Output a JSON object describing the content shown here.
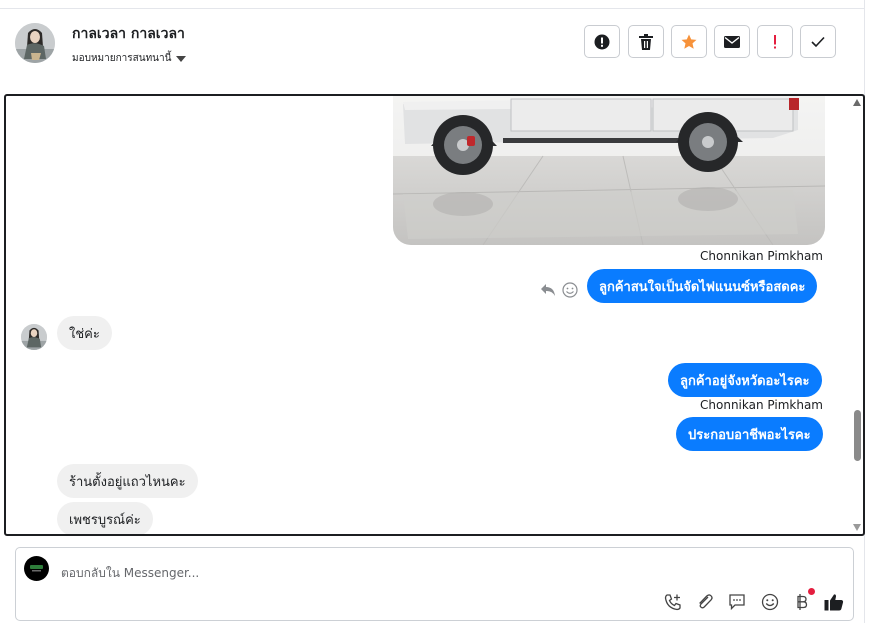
{
  "header": {
    "contact_name": "กาลเวลา กาลเวลา",
    "assign_label": "มอบหมายการสนทนานี้",
    "toolbar": [
      {
        "name": "spam-button",
        "icon": "alert-circle-icon"
      },
      {
        "name": "delete-button",
        "icon": "trash-icon"
      },
      {
        "name": "star-button",
        "icon": "star-icon"
      },
      {
        "name": "mark-unread-button",
        "icon": "envelope-icon"
      },
      {
        "name": "priority-button",
        "icon": "exclamation-icon"
      },
      {
        "name": "done-button",
        "icon": "check-icon"
      }
    ]
  },
  "messages": [
    {
      "kind": "image",
      "direction": "out",
      "description_icon": "car-photo"
    },
    {
      "sender": "Chonnikan Pimkham"
    },
    {
      "direction": "out",
      "text": "ลูกค้าสนใจเป็นจัดไฟแนนซ์หรือสดคะ"
    },
    {
      "direction": "in",
      "text": "ใช่ค่ะ"
    },
    {
      "direction": "out",
      "text": "ลูกค้าอยู่จังหวัดอะไรคะ"
    },
    {
      "sender": "Chonnikan Pimkham"
    },
    {
      "direction": "out",
      "text": "ประกอบอาชีพอะไรคะ"
    },
    {
      "direction": "in",
      "text": "ร้านตั้งอยู่แถวไหนคะ"
    },
    {
      "direction": "in",
      "text": "เพชรบูรณ์ค่ะ"
    }
  ],
  "composer": {
    "placeholder": "ตอบกลับใน Messenger...",
    "icons": [
      "call-plus-icon",
      "attachment-icon",
      "saved-reply-icon",
      "emoji-icon",
      "baht-icon",
      "thumbs-up-icon"
    ]
  },
  "colors": {
    "accent": "#0a7cff",
    "incoming": "#f0f0f0",
    "star": "#f7923a",
    "priority": "#e41e3f"
  }
}
